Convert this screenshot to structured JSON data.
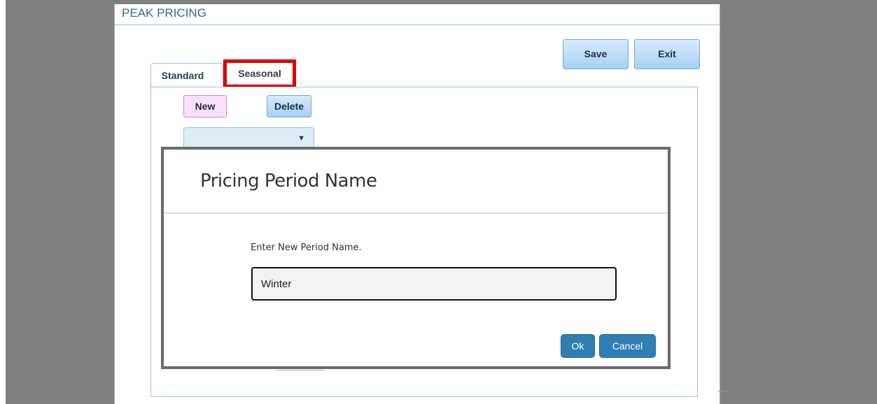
{
  "window": {
    "title": "PEAK PRICING"
  },
  "toolbar": {
    "save_label": "Save",
    "exit_label": "Exit"
  },
  "tabs": [
    {
      "label": "Standard",
      "active": false
    },
    {
      "label": "Seasonal",
      "active": true,
      "highlighted": true
    }
  ],
  "seasonal_panel": {
    "new_label": "New",
    "delete_label": "Delete",
    "period_select": {
      "selected_value": "",
      "icon": "caret-down-icon"
    }
  },
  "dialog": {
    "title": "Pricing Period Name",
    "prompt": "Enter New Period Name.",
    "input_value": "Winter",
    "ok_label": "Ok",
    "cancel_label": "Cancel"
  },
  "colors": {
    "backdrop": "#808080",
    "title_text": "#2a6f97",
    "highlight_border": "#e00000",
    "primary_button": "#2f7db3",
    "new_button": "#fbe0fb",
    "light_button": "#a8d0f3"
  }
}
